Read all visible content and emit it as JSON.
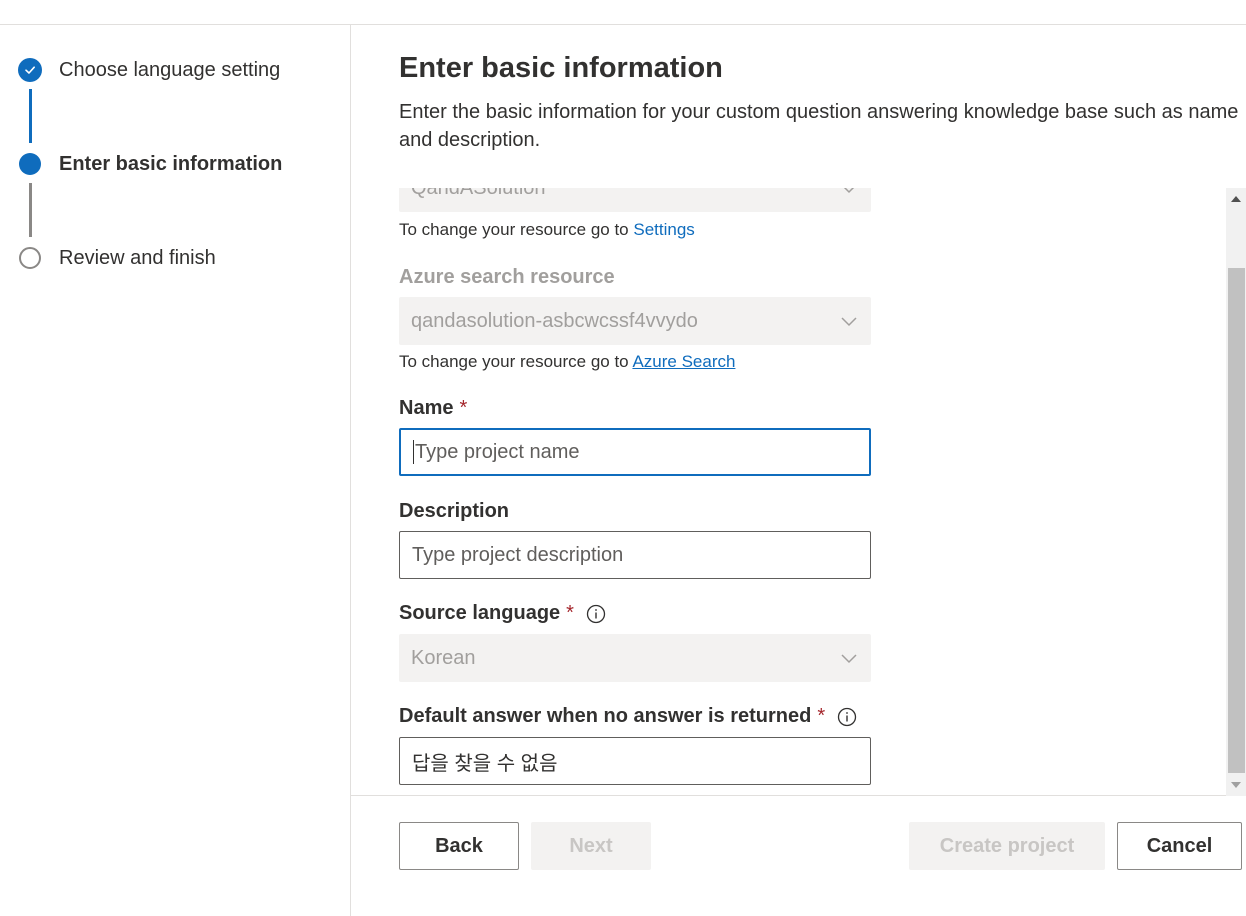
{
  "stepper": {
    "steps": [
      {
        "label": "Choose language setting",
        "state": "completed"
      },
      {
        "label": "Enter basic information",
        "state": "current"
      },
      {
        "label": "Review and finish",
        "state": "pending"
      }
    ]
  },
  "header": {
    "title": "Enter basic information",
    "description": "Enter the basic information for your custom question answering knowledge base such as name and description."
  },
  "form": {
    "language_resource": {
      "value": "QandASolution",
      "hint_prefix": "To change your resource go to ",
      "hint_link": "Settings"
    },
    "search_resource": {
      "label": "Azure search resource",
      "value": "qandasolution-asbcwcssf4vvydo",
      "hint_prefix": "To change your resource go to ",
      "hint_link": "Azure Search"
    },
    "name": {
      "label": "Name",
      "required_mark": "*",
      "placeholder": "Type project name"
    },
    "description": {
      "label": "Description",
      "placeholder": "Type project description"
    },
    "source_language": {
      "label": "Source language",
      "required_mark": "*",
      "value": "Korean"
    },
    "default_answer": {
      "label": "Default answer when no answer is returned",
      "required_mark": "*",
      "value": "답을 찾을 수 없음"
    }
  },
  "footer": {
    "back_label": "Back",
    "next_label": "Next",
    "create_label": "Create project",
    "cancel_label": "Cancel"
  },
  "colors": {
    "accent": "#0f6cbd",
    "required": "#a4262c",
    "disabled_bg": "#f3f2f1"
  }
}
